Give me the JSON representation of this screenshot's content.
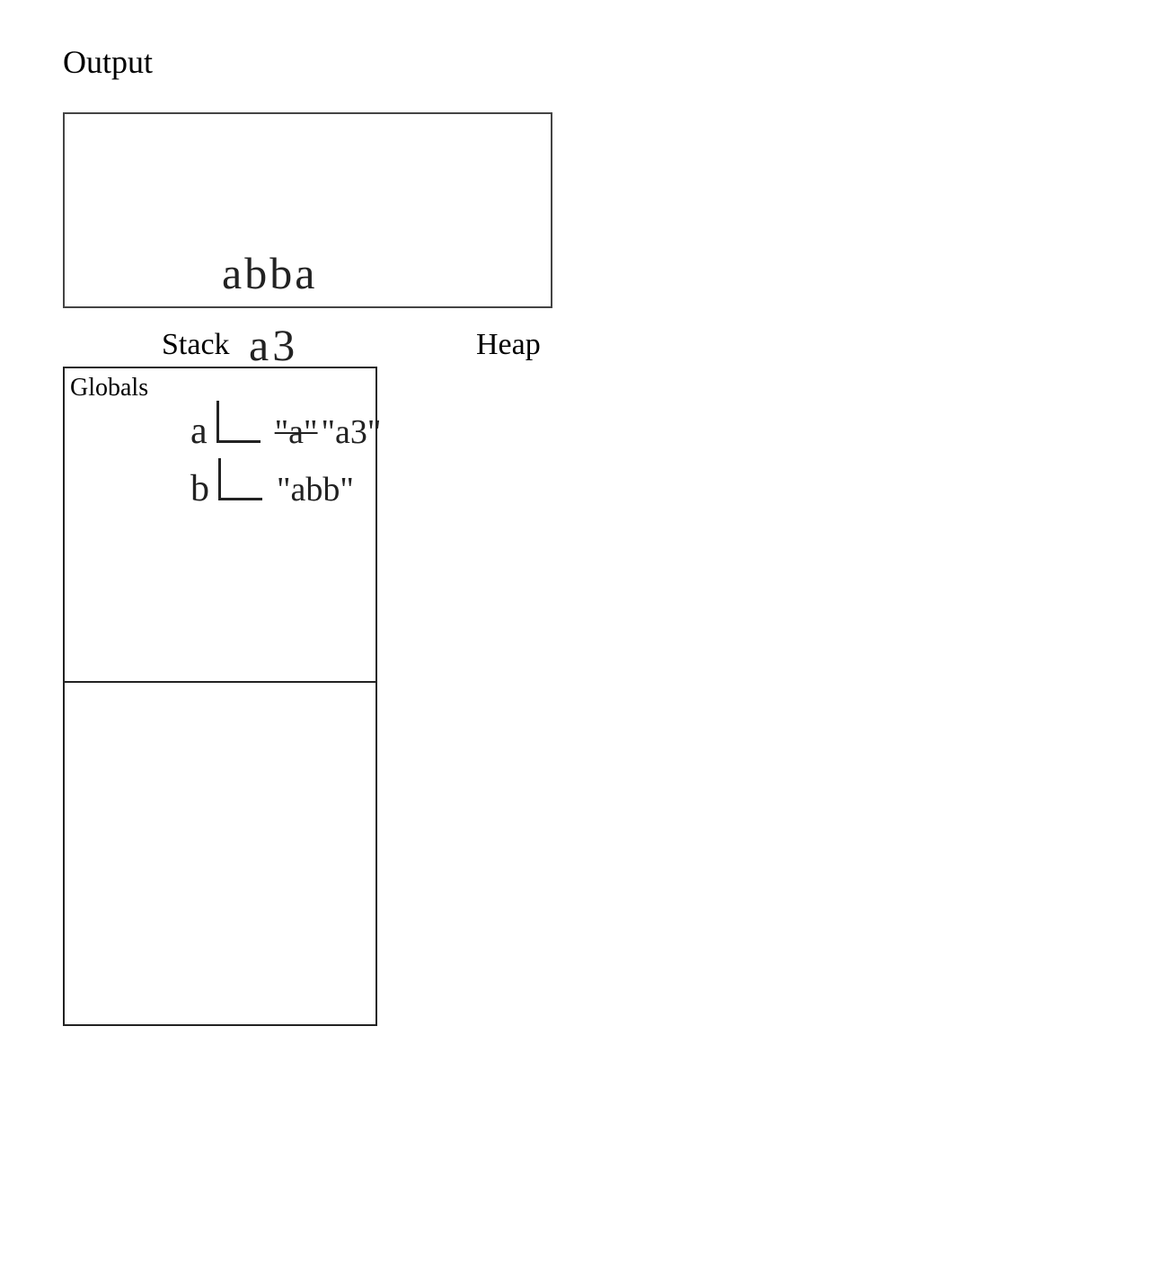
{
  "labels": {
    "output": "Output",
    "stack": "Stack",
    "heap": "Heap",
    "globals": "Globals"
  },
  "output_lines": {
    "line1": "abba",
    "line2": "a3"
  },
  "stack": {
    "globals": {
      "vars": {
        "a": {
          "name": "a",
          "old_value": "\"a\"",
          "new_value": "\"a3\""
        },
        "b": {
          "name": "b",
          "value": "\"abb\""
        }
      }
    }
  }
}
